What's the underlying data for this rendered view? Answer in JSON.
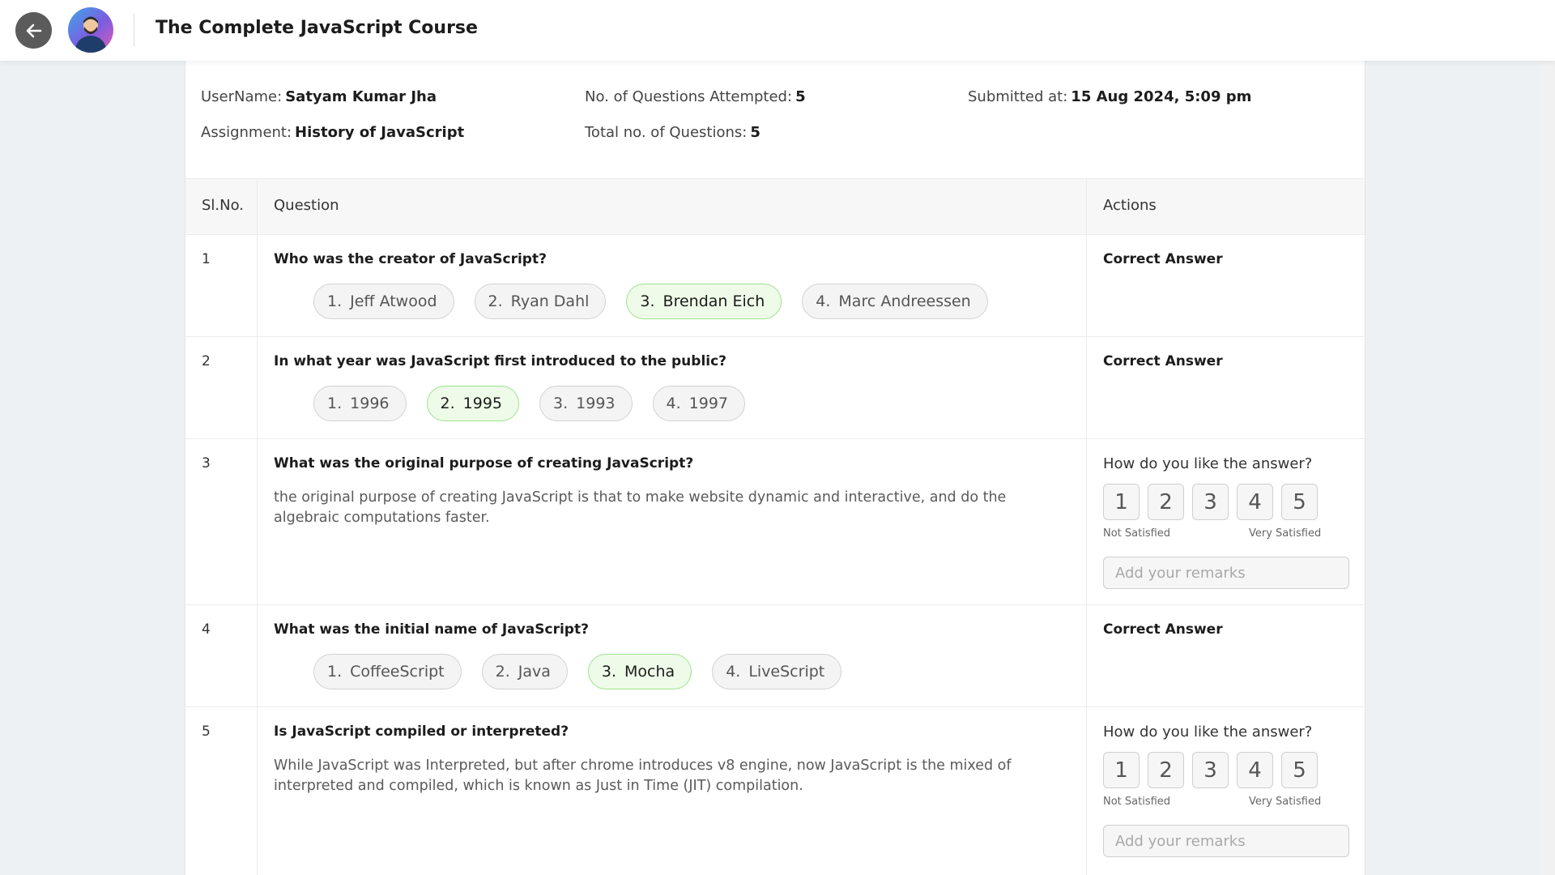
{
  "header": {
    "title": "The Complete JavaScript Course",
    "back_icon": "arrow-left-icon",
    "avatar": "user-avatar"
  },
  "summary": {
    "username_label": "UserName:",
    "username": "Satyam Kumar Jha",
    "attempted_label": "No. of Questions Attempted:",
    "attempted": "5",
    "submitted_label": "Submitted at:",
    "submitted": "15 Aug 2024, 5:09 pm",
    "assignment_label": "Assignment:",
    "assignment": "History of JavaScript",
    "total_label": "Total no. of Questions:",
    "total": "5"
  },
  "table": {
    "headers": {
      "slno": "Sl.No.",
      "question": "Question",
      "actions": "Actions"
    },
    "rows": [
      {
        "slno": "1",
        "question": "Who was the creator of JavaScript?",
        "type": "mcq",
        "options": [
          {
            "num": "1.",
            "text": "Jeff Atwood"
          },
          {
            "num": "2.",
            "text": "Ryan Dahl"
          },
          {
            "num": "3.",
            "text": "Brendan Eich"
          },
          {
            "num": "4.",
            "text": "Marc Andreessen"
          }
        ],
        "correct_index": 2,
        "action": "Correct Answer"
      },
      {
        "slno": "2",
        "question": "In what year was JavaScript first introduced to the public?",
        "type": "mcq",
        "options": [
          {
            "num": "1.",
            "text": "1996"
          },
          {
            "num": "2.",
            "text": "1995"
          },
          {
            "num": "3.",
            "text": "1993"
          },
          {
            "num": "4.",
            "text": "1997"
          }
        ],
        "correct_index": 1,
        "action": "Correct Answer"
      },
      {
        "slno": "3",
        "question": "What was the original purpose of creating JavaScript?",
        "type": "text",
        "answer": "the original purpose of creating JavaScript is that to make website dynamic and interactive, and do the algebraic computations faster.",
        "rating_question": "How do you like the answer?",
        "rating_low": "Not Satisfied",
        "rating_high": "Very Satisfied",
        "ratings": [
          "1",
          "2",
          "3",
          "4",
          "5"
        ],
        "remarks_placeholder": "Add your remarks"
      },
      {
        "slno": "4",
        "question": "What was the initial name of JavaScript?",
        "type": "mcq",
        "options": [
          {
            "num": "1.",
            "text": "CoffeeScript"
          },
          {
            "num": "2.",
            "text": "Java"
          },
          {
            "num": "3.",
            "text": "Mocha"
          },
          {
            "num": "4.",
            "text": "LiveScript"
          }
        ],
        "correct_index": 2,
        "action": "Correct Answer"
      },
      {
        "slno": "5",
        "question": "Is JavaScript compiled or interpreted?",
        "type": "text",
        "answer": "While JavaScript was Interpreted, but after chrome introduces v8 engine, now JavaScript is the mixed of interpreted and compiled, which is known as Just in Time (JIT) compilation.",
        "rating_question": "How do you like the answer?",
        "rating_low": "Not Satisfied",
        "rating_high": "Very Satisfied",
        "ratings": [
          "1",
          "2",
          "3",
          "4",
          "5"
        ],
        "remarks_placeholder": "Add your remarks"
      }
    ]
  },
  "colors": {
    "correct_bg": "#eefbe8",
    "correct_border": "#9ee28d",
    "back_button": "#5b5b5b"
  }
}
